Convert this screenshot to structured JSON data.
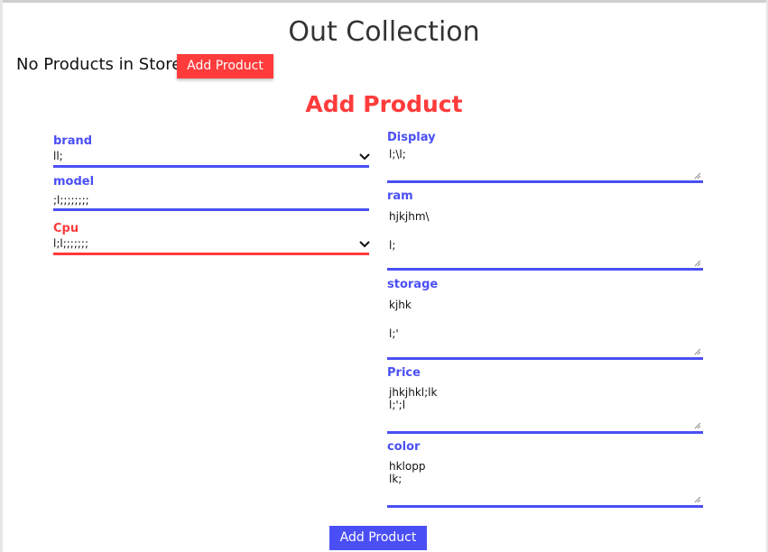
{
  "page": {
    "title": "Out Collection",
    "empty_message": "No Products in Store",
    "add_product_top": "Add Product",
    "form_title": "Add Product",
    "submit_label": "Add Product"
  },
  "left_fields": {
    "brand": {
      "label": "brand",
      "value": "ll;"
    },
    "model": {
      "label": "model",
      "value": ";l;;;;;;;;"
    },
    "cpu": {
      "label": "Cpu",
      "value": "l;l;;;;;;;"
    }
  },
  "right_fields": {
    "display": {
      "label": "Display",
      "value": "l;\\l;"
    },
    "ram": {
      "label": "ram",
      "value": "hjkjhm\\\n\nl;"
    },
    "storage": {
      "label": "storage",
      "value": "kjhk\n\nl;'"
    },
    "price": {
      "label": "Price",
      "value": "jhkjhkl;lk\nl;';l"
    },
    "color": {
      "label": "color",
      "value": "hklopp\nlk;"
    }
  },
  "colors": {
    "accent_blue": "#4a4ff5",
    "accent_red": "#ff3b3b"
  },
  "icons": {
    "select_arrow": "chevron-down-icon",
    "resize_grip": "resize-grip-icon"
  }
}
